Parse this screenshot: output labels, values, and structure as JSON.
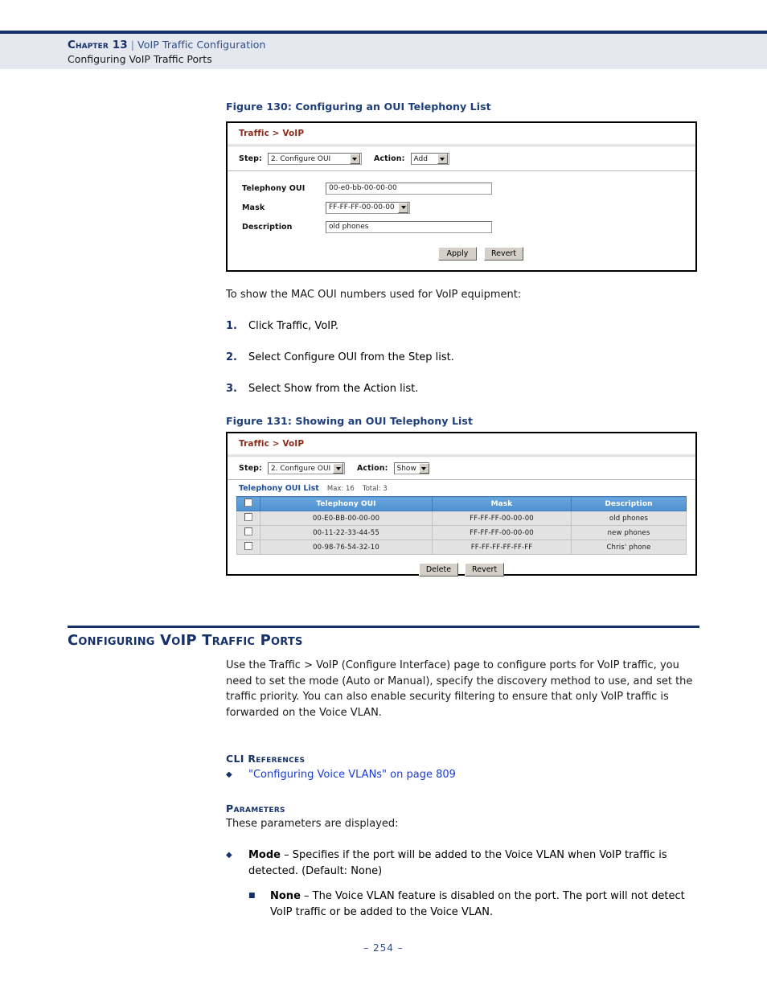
{
  "header": {
    "chapter": "Chapter 13",
    "separator": "|",
    "chapter_title": "VoIP Traffic Configuration",
    "subtitle": "Configuring VoIP Traffic Ports"
  },
  "figure130": {
    "caption": "Figure 130:  Configuring an OUI Telephony List",
    "panel_title": "Traffic > VoIP",
    "step_label": "Step:",
    "step_value": "2. Configure OUI",
    "action_label": "Action:",
    "action_value": "Add",
    "fields": [
      {
        "label": "Telephony OUI",
        "value": "00-e0-bb-00-00-00",
        "type": "text"
      },
      {
        "label": "Mask",
        "value": "FF-FF-FF-00-00-00",
        "type": "select"
      },
      {
        "label": "Description",
        "value": "old phones",
        "type": "text"
      }
    ],
    "apply_label": "Apply",
    "revert_label": "Revert"
  },
  "intro": {
    "lead": "To show the MAC OUI numbers used for VoIP equipment:",
    "steps": [
      {
        "num": "1.",
        "text": "Click Traffic, VoIP."
      },
      {
        "num": "2.",
        "text": "Select Configure OUI from the Step list."
      },
      {
        "num": "3.",
        "text": "Select Show from the Action list."
      }
    ]
  },
  "figure131": {
    "caption": "Figure 131:  Showing an OUI Telephony List",
    "panel_title": "Traffic > VoIP",
    "step_label": "Step:",
    "step_value": "2. Configure OUI",
    "action_label": "Action:",
    "action_value": "Show",
    "list_title": "Telephony OUI List",
    "list_max": "Max: 16",
    "list_total": "Total: 3",
    "columns": [
      "",
      "Telephony OUI",
      "Mask",
      "Description"
    ],
    "rows": [
      {
        "oui": "00-E0-BB-00-00-00",
        "mask": "FF-FF-FF-00-00-00",
        "desc": "old phones"
      },
      {
        "oui": "00-11-22-33-44-55",
        "mask": "FF-FF-FF-00-00-00",
        "desc": "new phones"
      },
      {
        "oui": "00-98-76-54-32-10",
        "mask": "FF-FF-FF-FF-FF-FF",
        "desc": "Chris' phone"
      }
    ],
    "delete_label": "Delete",
    "revert_label": "Revert"
  },
  "section": {
    "title": "Configuring VoIP Traffic Ports",
    "paragraph": "Use the Traffic > VoIP (Configure Interface) page to configure ports for VoIP traffic, you need to set the mode (Auto or Manual), specify the discovery method to use, and set the traffic priority. You can also enable security filtering to ensure that only VoIP traffic is forwarded on the Voice VLAN.",
    "cli_heading": "CLI References",
    "cli_link": "\"Configuring Voice VLANs\" on page 809",
    "params_heading": "Parameters",
    "params_lead": "These parameters are displayed:",
    "mode_term": "Mode",
    "mode_text": " – Specifies if the port will be added to the Voice VLAN when VoIP traffic is detected. (Default: None)",
    "none_term": "None",
    "none_text": " – The Voice VLAN feature is disabled on the port. The port will not detect VoIP traffic or be added to the Voice VLAN."
  },
  "footer": {
    "page_number": "–  254  –"
  },
  "colors": {
    "navy": "#16306a",
    "header_band": "#e6e8f0",
    "panel_title": "#8c2b1b",
    "table_header": "#5b9bd5",
    "link": "#1a3ad6"
  }
}
